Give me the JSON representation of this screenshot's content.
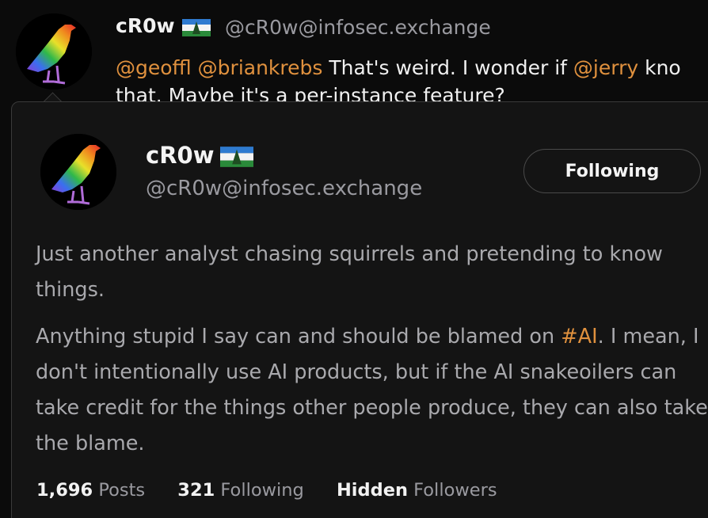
{
  "post": {
    "display_name": "cR0w",
    "handle": "@cR0w@infosec.exchange",
    "mentions": [
      "@geoffl",
      "@briankrebs"
    ],
    "text_mid": " That's weird. I wonder if ",
    "mention_inline": "@jerry",
    "text_tail": " kno",
    "line2": "that. Maybe it's a per-instance feature?"
  },
  "card": {
    "display_name": "cR0w",
    "handle": "@cR0w@infosec.exchange",
    "follow_button_label": "Following",
    "bio_p1": "Just another analyst chasing squirrels and pretending to know things.",
    "bio_p2_before": "Anything stupid I say can and should be blamed on ",
    "bio_hashtag": "#AI",
    "bio_p2_after": ". I mean, I don't intentionally use AI products, but if the AI snakeoilers can take credit for the things other people produce, they can also take the blame.",
    "stats": {
      "posts_count": "1,696",
      "posts_label": "Posts",
      "following_count": "321",
      "following_label": "Following",
      "followers_count": "Hidden",
      "followers_label": "Followers"
    }
  },
  "colors": {
    "accent": "#e0913e",
    "background": "#0b0b0b",
    "card": "#141414",
    "muted_text": "#9a9aa0"
  },
  "icons": {
    "avatar": "rainbow-crow-avatar",
    "flag": "cascadia-flag-icon"
  }
}
